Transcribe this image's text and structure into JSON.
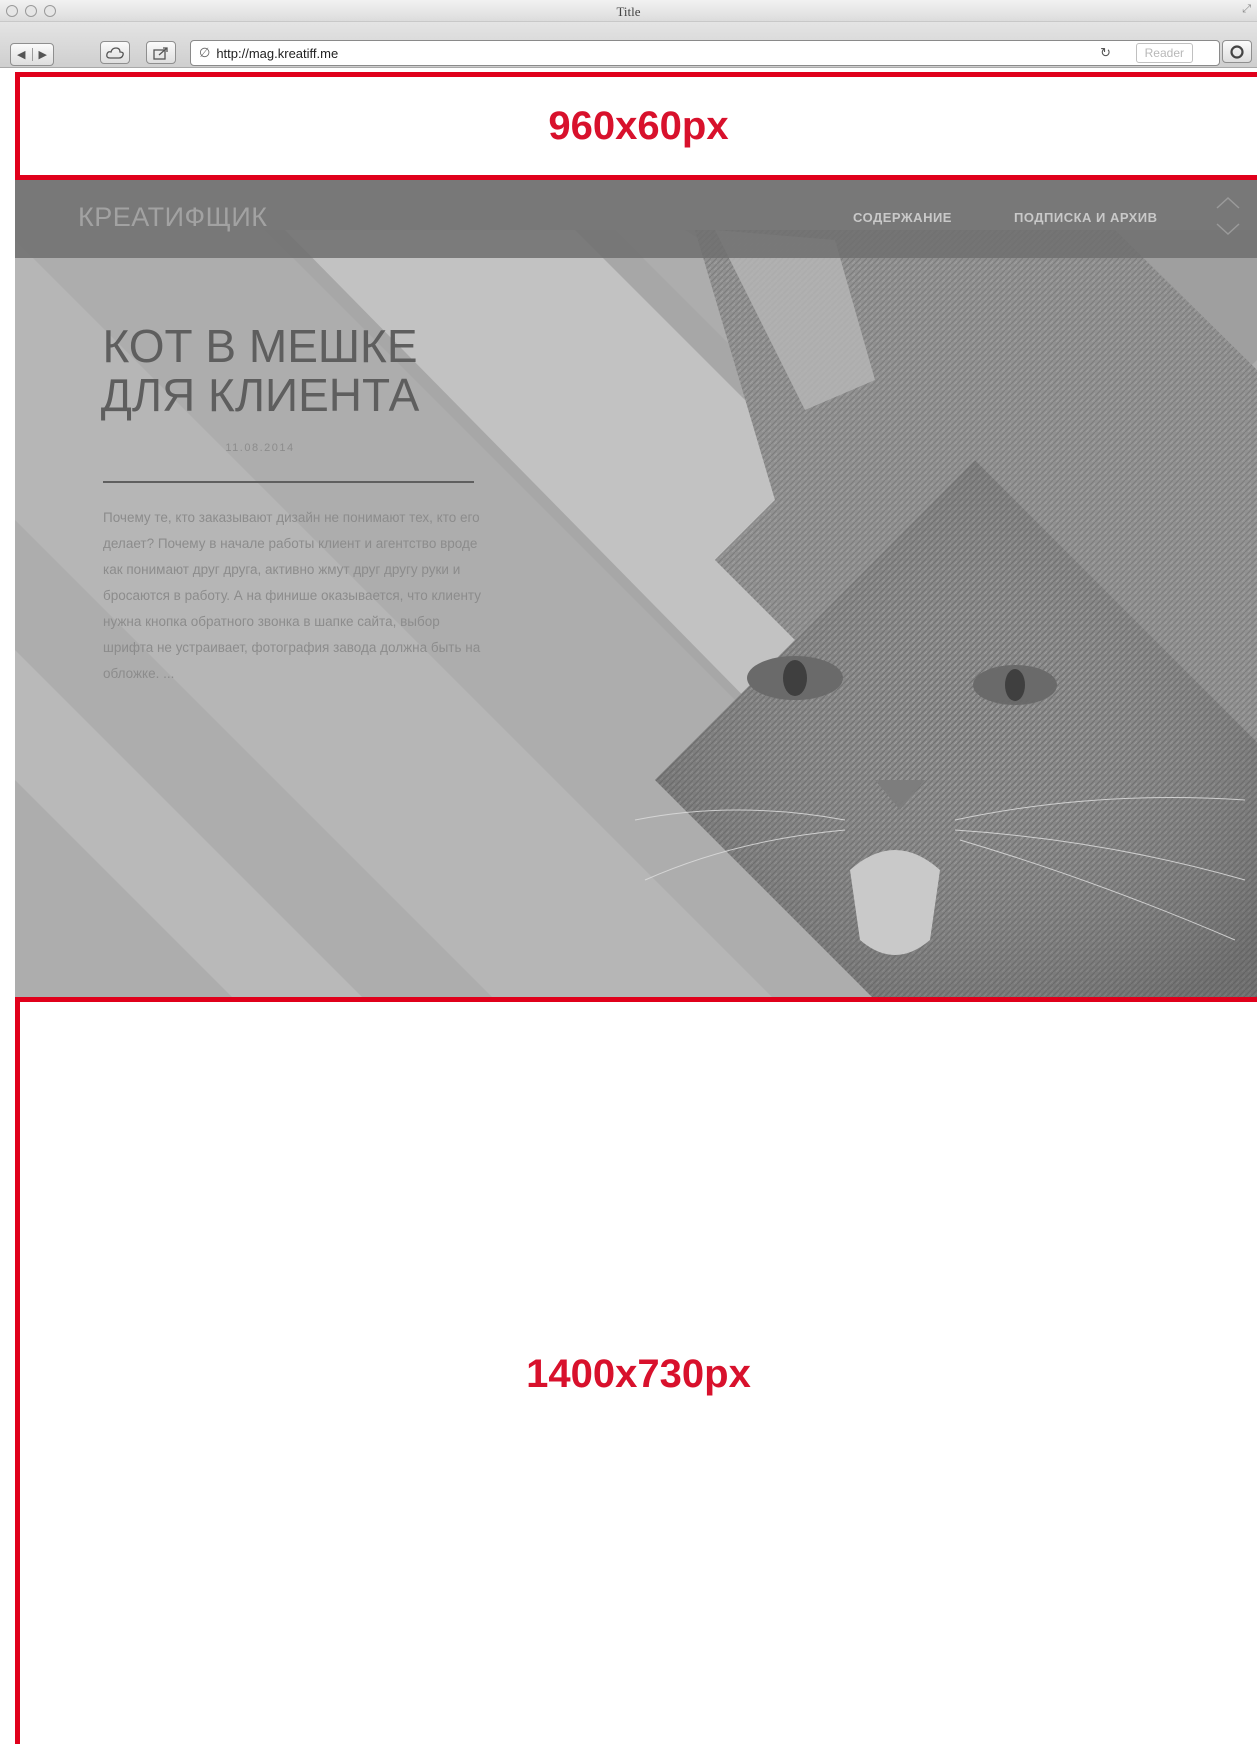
{
  "browser": {
    "window_title": "Title",
    "url": "http://mag.kreatiff.me",
    "reader_label": "Reader"
  },
  "annotations": {
    "top_label": "960x60px",
    "bottom_label": "1400x730px",
    "color": "#e0001b"
  },
  "site": {
    "brand": "КРЕАТИФЩИК",
    "nav": [
      "СОДЕРЖАНИЕ",
      "ПОДПИСКА И АРХИВ"
    ]
  },
  "article": {
    "title_line1": "КОТ В МЕШКЕ",
    "title_line2": "ДЛЯ КЛИЕНТА",
    "date": "11.08.2014",
    "excerpt": "Почему те, кто заказывают дизайн не понимают тех, кто его делает? Почему в начале работы клиент и агентство вроде как понимают друг друга, активно жмут друг другу руки и бросаются в работу. А на финише оказывается, что клиенту нужна кнопка обратного звонка в шапке сайта, выбор шрифта не устраивает, фотография завода должна быть на обложке. ..."
  },
  "icons": {
    "back": "back-arrow-icon",
    "forward": "forward-arrow-icon",
    "cloud": "cloud-icon",
    "share": "share-icon",
    "reload": "reload-icon",
    "scroll_arrows": "chevron-up-down-icon"
  }
}
